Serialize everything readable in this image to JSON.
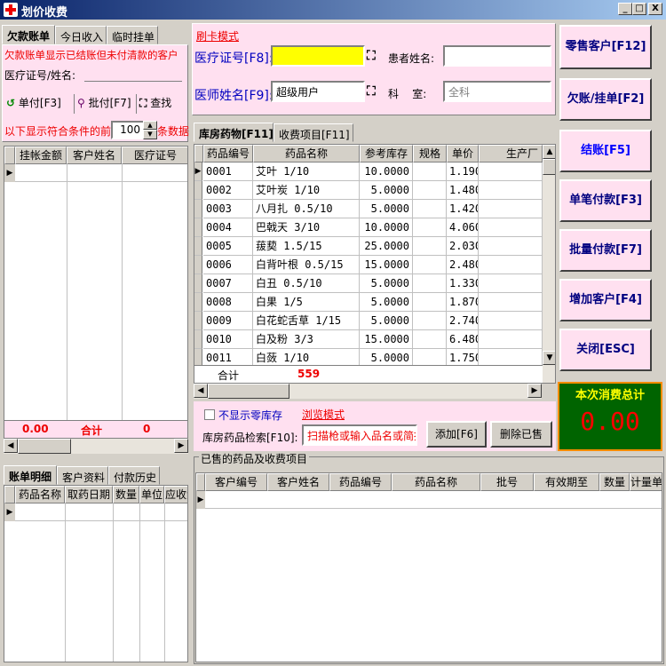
{
  "window": {
    "title": "划价收费",
    "min": "_",
    "max": "□",
    "close": "X"
  },
  "left_tabs": [
    "欠款账单",
    "今日收入",
    "临时挂单"
  ],
  "left": {
    "notice": "欠款账单显示已结账但未付清款的客户",
    "id_name_label": "医疗证号/姓名:",
    "single_pay": "单付[F3]",
    "batch_pay": "批付[F7]",
    "search": "查找",
    "limit_prefix": "以下显示符合条件的前",
    "limit_value": "100",
    "limit_suffix": "条数据",
    "cols": [
      "挂帐金额",
      "客户姓名",
      "医疗证号"
    ],
    "total_amount": "0.00",
    "total_label": "合计",
    "total_count": "0"
  },
  "left_bottom_tabs": [
    "账单明细",
    "客户资料",
    "付款历史"
  ],
  "left_bottom_cols": [
    "药品名称",
    "取药日期",
    "数量",
    "单位",
    "应收金"
  ],
  "mid": {
    "mode_label": "刷卡模式",
    "card_label": "医疗证号[F8]:",
    "card_value": "",
    "patient_label": "患者姓名:",
    "patient_value": "",
    "doctor_label": "医师姓名[F9]:",
    "doctor_value": "超级用户",
    "dept_label": "科    室:",
    "dept_value": "全科"
  },
  "mid_tabs": [
    "库房药物[F11]",
    "收费项目[F11]"
  ],
  "drug_cols": [
    "药品编号",
    "药品名称",
    "参考库存",
    "规格",
    "单价",
    "生产厂"
  ],
  "drugs": [
    [
      "0001",
      "艾叶 1/10",
      "10.0000",
      "",
      "1.190"
    ],
    [
      "0002",
      "艾叶炭 1/10",
      "5.0000",
      "",
      "1.480"
    ],
    [
      "0003",
      "八月扎 0.5/10",
      "5.0000",
      "",
      "1.420"
    ],
    [
      "0004",
      "巴戟天 3/10",
      "10.0000",
      "",
      "4.060"
    ],
    [
      "0005",
      "菝葜 1.5/15",
      "25.0000",
      "",
      "2.030"
    ],
    [
      "0006",
      "白背叶根 0.5/15",
      "15.0000",
      "",
      "2.480"
    ],
    [
      "0007",
      "白丑 0.5/10",
      "5.0000",
      "",
      "1.330"
    ],
    [
      "0008",
      "白果 1/5",
      "5.0000",
      "",
      "1.870"
    ],
    [
      "0009",
      "白花蛇舌草 1/15",
      "5.0000",
      "",
      "2.740"
    ],
    [
      "0010",
      "白及粉 3/3",
      "15.0000",
      "",
      "6.480"
    ],
    [
      "0011",
      "白蔹 1/10",
      "5.0000",
      "",
      "1.750"
    ]
  ],
  "drug_total_label": "合计",
  "drug_total_value": "559",
  "filter": {
    "no_zero_stock": "不显示零库存",
    "browse_mode": "浏览模式",
    "search_label": "库房药品检索[F10]:",
    "search_placeholder": "扫描枪或输入品名或简拼",
    "add": "添加[F6]",
    "delete": "删除已售"
  },
  "sold": {
    "group_label": "已售的药品及收费项目",
    "cols": [
      "客户编号",
      "客户姓名",
      "药品编号",
      "药品名称",
      "批号",
      "有效期至",
      "数量",
      "计量单"
    ]
  },
  "right_buttons": [
    "零售客户[F12]",
    "欠账/挂单[F2]",
    "结账[F5]",
    "单笔付款[F3]",
    "批量付款[F7]",
    "增加客户[F4]",
    "关闭[ESC]"
  ],
  "total_panel": {
    "title": "本次消费总计",
    "value": "0.00"
  },
  "colors": {
    "titlebar": "#0a246a",
    "pink": "#ffe0f0",
    "yellow": "#ffff00",
    "green": "#006400",
    "red": "#e00000"
  }
}
